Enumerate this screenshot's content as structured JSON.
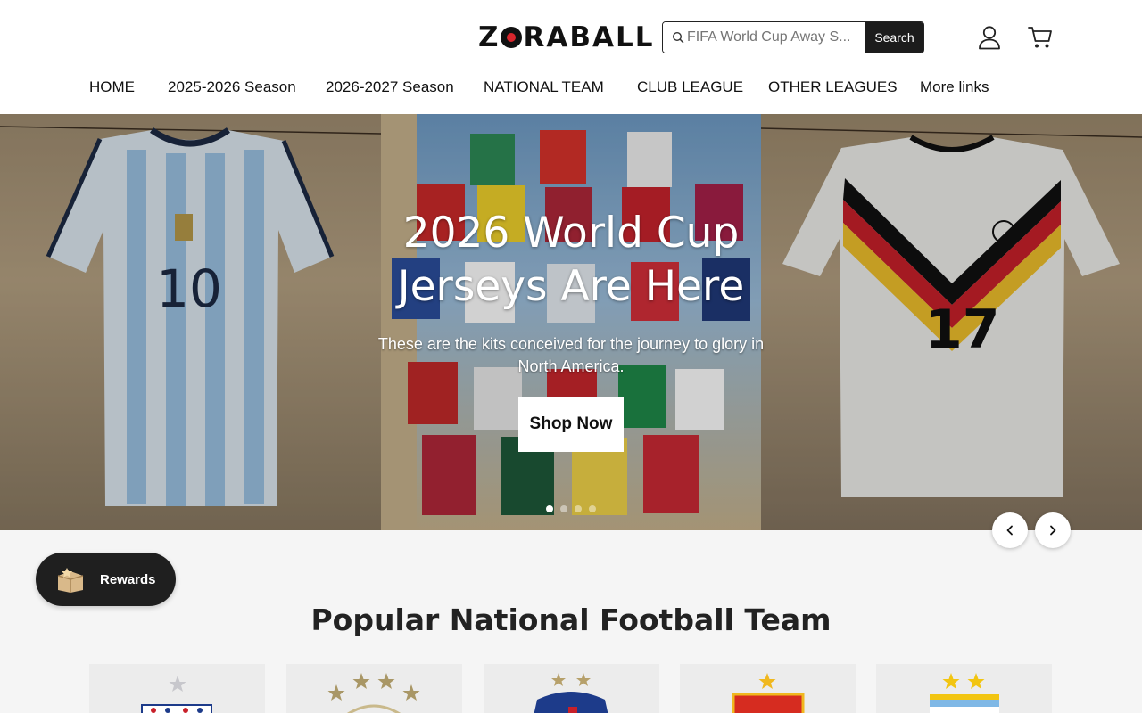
{
  "header": {
    "logo_text": "ZORABALL",
    "search": {
      "placeholder": "FIFA World Cup Away S...",
      "button_label": "Search"
    },
    "icons": {
      "search": "search-icon",
      "account": "user-icon",
      "cart": "cart-icon"
    }
  },
  "nav": {
    "items": [
      {
        "label": "HOME"
      },
      {
        "label": "2025-2026 Season"
      },
      {
        "label": "2026-2027 Season"
      },
      {
        "label": "NATIONAL TEAM"
      },
      {
        "label": "CLUB LEAGUE"
      },
      {
        "label": "OTHER LEAGUES"
      },
      {
        "label": "More links"
      }
    ]
  },
  "hero": {
    "title_line1": "2026 World Cup",
    "title_line2": "Jerseys Are Here",
    "subtitle": "These are the kits conceived for the journey to glory in North America.",
    "cta_label": "Shop Now",
    "slides_count": 4,
    "active_slide": 1,
    "left_jersey_number": "10",
    "right_jersey_number": "17"
  },
  "rewards": {
    "label": "Rewards",
    "icon": "gift-box-icon"
  },
  "section": {
    "title": "Popular National Football Team"
  },
  "colors": {
    "brand_dark": "#1c1c1c",
    "accent_red": "#d8262d",
    "background_light": "#f5f5f5"
  }
}
